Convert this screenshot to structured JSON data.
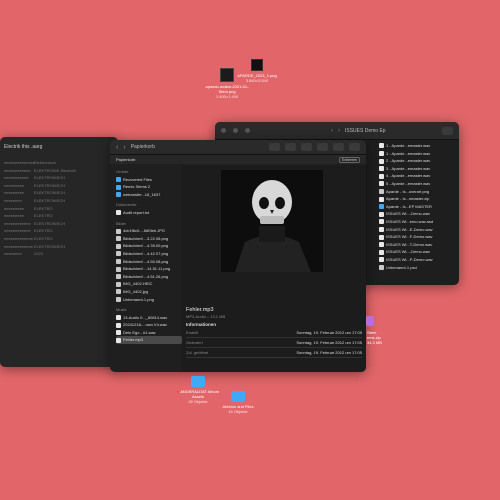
{
  "desktop": {
    "icon1": {
      "name": "apasdo-avatar-2021-01-",
      "name2": "Stem.png",
      "size": "1.400×1.400"
    },
    "icon2": {
      "name": "APARDE_2023_1.png",
      "size": "3.840×3.840"
    },
    "folder1": {
      "name": "ANDERALDAT Album",
      "name2": "Assets",
      "count": "26 Objekte"
    },
    "folder2": {
      "name": "Ableton and Files",
      "count": "15 Objekte"
    }
  },
  "left_window": {
    "title": "Electrik this .aarg",
    "labels": [
      "Elektronisch",
      "ELEKTRONIK ElectroN",
      "ELEKTRONISCH",
      "ELEKTRONISCH",
      "ELEKTRONISCH",
      "ELEKTRONISCH",
      "ELEKTRO",
      "ELEKTRO",
      "ELEKTRONISCH",
      "ELEKTRO",
      "ELEKTRO",
      "ELEKTRONISCH",
      "2023"
    ],
    "prefixes": [
      "eeeeeeeeeeeeee",
      "eeeeeeeeeeee",
      "eeeeeeeeeee",
      "eeeeeeeee",
      "eeeeeeeee",
      "eeeeeeee",
      "eeeeeeeee",
      "eeeeeeeee",
      "eeeeeeeeeeee",
      "eeeeeeeeeeee",
      "eeeeeeeeeeeee",
      "eeeeeeeeeeeee",
      "eeeeeeee"
    ]
  },
  "back_window": {
    "title": "ISSUES Demo Ep",
    "files": [
      "1 - Aparde...emaster.wav",
      "1 - Aparde...emaster.wav",
      "2 - Aparde...emaster.wav",
      "3 - Aparde...emaster.wav",
      "4 - Aparde...emaster.wav",
      "5 - Aparde...emaster.wav",
      "Aparde - Is...overart.png",
      "Aparde - Is...nmaster.zip",
      "Aparde - Is...EP MASTER",
      "ISSUES Wi...-Demo.wav",
      "ISSUES Wi...emo.wav.asd",
      "ISSUES Wi...E-Demo.wav",
      "ISSUES Wi...F-Demo.wav",
      "ISSUES Wi...T-Demo.wav",
      "ISSUES Wi...-Demo.wav",
      "ISSUES Wi...P-Demo.wav",
      "Unbenannt-1.psd"
    ]
  },
  "trash_window": {
    "title": "Papierkorb",
    "location": "Papierkorb",
    "empty_button": "Entleeren",
    "sections": [
      {
        "header": "Ordner",
        "items": [
          "Recovered Files",
          "Remix Stems 2",
          "wetransfer...18_1637"
        ]
      },
      {
        "header": "Dokumente",
        "items": [
          "Audit report.txt"
        ]
      },
      {
        "header": "Bilder",
        "items": [
          "4cb1f6c0-...68f3eb.JPG",
          "Bildschirmf....3.22.08.png",
          "Bildschirmf....4.39.00.png",
          "Bildschirmf....4.42.07.png",
          "Bildschirmf....4.50.08.png",
          "Bildschirmf....14.51.11.png",
          "Bildschirmf....4.51.26.png",
          "IMG_4402.HEIC",
          "IMG_4402.jpg",
          "Unbenannt-1.png"
        ]
      },
      {
        "header": "Musik",
        "items": [
          "13-Audio 0..._60814.wav",
          "20241218-...own V4.wav",
          "Dein Ego - #1.wav",
          "Fehler.mp3"
        ]
      }
    ],
    "preview": {
      "filename": "Fehler.mp3",
      "subtitle": "MP3-Audio – 13,1 MB",
      "info_header": "Informationen",
      "rows": [
        {
          "label": "Erstellt",
          "value": "Sonntag, 19. Februar 2012 um 17:05"
        },
        {
          "label": "Geändert",
          "value": "Sonntag, 19. Februar 2012 um 17:05"
        },
        {
          "label": "Zul. geöffnet",
          "value": "Sonntag, 19. Februar 2012 um 17:05"
        }
      ]
    }
  },
  "peek": {
    "text1": "Stem",
    "text2": "ems.zip",
    "text3": "34,3 MB"
  }
}
